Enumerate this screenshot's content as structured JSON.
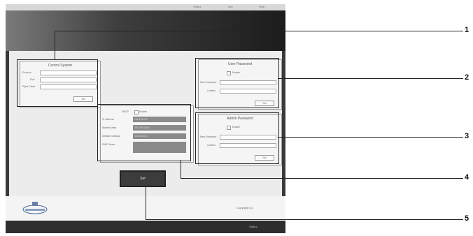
{
  "topbar": {
    "items": [
      "Status",
      "Info",
      "Help"
    ]
  },
  "control_system": {
    "title": "Control System",
    "fields": [
      {
        "label": "Protocol",
        "value": ""
      },
      {
        "label": "Port",
        "value": ""
      },
      {
        "label": "Pjlink Class",
        "value": ""
      }
    ],
    "set_label": "Set"
  },
  "user_password": {
    "title": "User Password",
    "enable_label": "Enable",
    "fields": [
      {
        "label": "New Password",
        "value": ""
      },
      {
        "label": "Confirm",
        "value": ""
      }
    ],
    "set_label": "Set"
  },
  "admin_password": {
    "title": "Admin Password",
    "enable_label": "Enable",
    "fields": [
      {
        "label": "New Password",
        "value": ""
      },
      {
        "label": "Confirm",
        "value": ""
      }
    ],
    "set_label": "Set"
  },
  "network": {
    "dhcp_label": "DHCP",
    "dhcp_option": "Enable",
    "rows": [
      {
        "label": "IP Address",
        "value": "192.168.0.8"
      },
      {
        "label": "Subnet Mask",
        "value": "255.255.255.0"
      },
      {
        "label": "Default Gateway",
        "value": "192.168.0.1"
      },
      {
        "label": "DNS Server",
        "value": ""
      }
    ]
  },
  "set_button": "Set",
  "footer": {
    "right_text": "Copyright (C)",
    "bottom_text": "Status"
  },
  "callouts": [
    "1",
    "2",
    "3",
    "4",
    "5"
  ]
}
